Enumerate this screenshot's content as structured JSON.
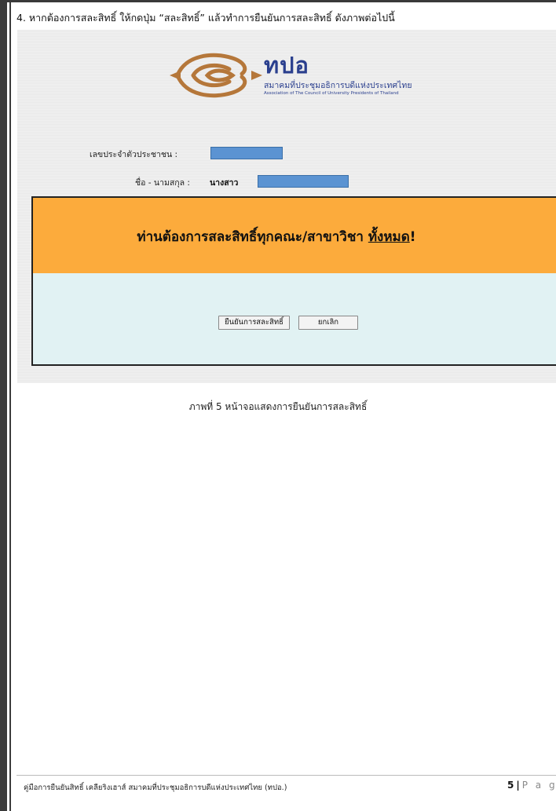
{
  "step": {
    "text": "4. หากต้องการสละสิทธิ์ ให้กดปุ่ม “สละสิทธิ์” แล้วทำการยืนยันการสละสิทธิ์ ดังภาพต่อไปนี้"
  },
  "screenshot": {
    "logo": {
      "abbr": "ทปอ",
      "name_th": "สมาคมที่ประชุมอธิการบดีแห่งประเทศไทย",
      "name_en": "Association of The Council of University Presidents of Thailand"
    },
    "form": {
      "id_label": "เลขประจำตัวประชาชน :",
      "name_label": "ชื่อ - นามสกุล :",
      "name_prefix": "นางสาว"
    },
    "dialog": {
      "message_main": "ท่านต้องการสละสิทธิ์ทุกคณะ/สาขาวิชา ",
      "message_emph": "ทั้งหมด",
      "message_end": "!",
      "confirm_label": "ยืนยันการสละสิทธิ์",
      "cancel_label": "ยกเลิก"
    }
  },
  "caption": "ภาพที่ 5 หน้าจอแสดงการยืนยันการสละสิทธิ์",
  "footer": {
    "left": "คู่มือการยืนยันสิทธิ์ เคลียริงเฮาส์ สมาคมที่ประชุมอธิการบดีแห่งประเทศไทย (ทปอ.)",
    "page_number": "5",
    "separator": "|",
    "page_word": "P a g"
  },
  "colors": {
    "dialog_header": "#fcab3c",
    "dialog_body": "#e1f2f3",
    "masked_field": "#5b93d2",
    "logo_brown": "#b5773a",
    "logo_blue": "#2a3f8e"
  }
}
